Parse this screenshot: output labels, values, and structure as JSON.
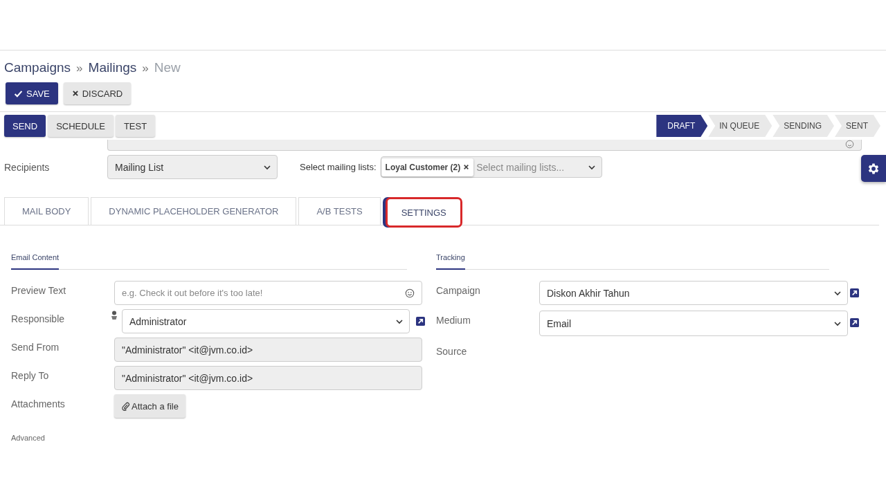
{
  "breadcrumb": [
    {
      "kind": "link",
      "label": "Campaigns"
    },
    {
      "kind": "sep",
      "label": "»"
    },
    {
      "kind": "link",
      "label": "Mailings"
    },
    {
      "kind": "sep",
      "label": "»"
    },
    {
      "kind": "current",
      "label": "New"
    }
  ],
  "toolbar": [
    {
      "kind": "primary",
      "label": "SAVE"
    },
    {
      "kind": "secondary",
      "label": "DISCARD"
    }
  ],
  "actions": [
    {
      "kind": "primary",
      "label": "SEND"
    },
    {
      "kind": "secondary",
      "label": "SCHEDULE"
    },
    {
      "kind": "secondary",
      "label": "TEST"
    }
  ],
  "stages": [
    {
      "label": "DRAFT",
      "selected": true
    },
    {
      "label": "IN QUEUE",
      "selected": false
    },
    {
      "label": "SENDING",
      "selected": false
    },
    {
      "label": "SENT",
      "selected": false
    }
  ],
  "recipients": {
    "label": "Recipients",
    "value": "Mailing List",
    "lists_label": "Select mailing lists:",
    "tags": [
      {
        "label": "Loyal Customer (2)"
      }
    ],
    "placeholder": "Select mailing lists..."
  },
  "tabs": [
    {
      "label": "MAIL BODY",
      "selected": false
    },
    {
      "label": "DYNAMIC PLACEHOLDER GENERATOR",
      "selected": false
    },
    {
      "label": "A/B TESTS",
      "selected": false
    },
    {
      "label": "SETTINGS",
      "selected": true
    }
  ],
  "email_content": {
    "title": "Email Content",
    "fields": [
      {
        "label": "Preview Text",
        "kind": "text",
        "placeholder": "e.g. Check it out before it's too late!"
      },
      {
        "label": "Responsible",
        "kind": "user",
        "value": "Administrator"
      },
      {
        "label": "Send From",
        "kind": "readonly",
        "value": "\"Administrator\" <it@jvm.co.id>"
      },
      {
        "label": "Reply To",
        "kind": "readonly",
        "value": "\"Administrator\" <it@jvm.co.id>"
      },
      {
        "label": "Attachments",
        "kind": "button",
        "value": "Attach a file"
      }
    ]
  },
  "tracking": {
    "title": "Tracking",
    "fields": [
      {
        "label": "Campaign",
        "kind": "select",
        "value": "Diskon Akhir Tahun"
      },
      {
        "label": "Medium",
        "kind": "select_readonly",
        "value": "Email"
      },
      {
        "label": "Source",
        "kind": "empty"
      }
    ]
  },
  "advanced": {
    "title": "Advanced"
  }
}
